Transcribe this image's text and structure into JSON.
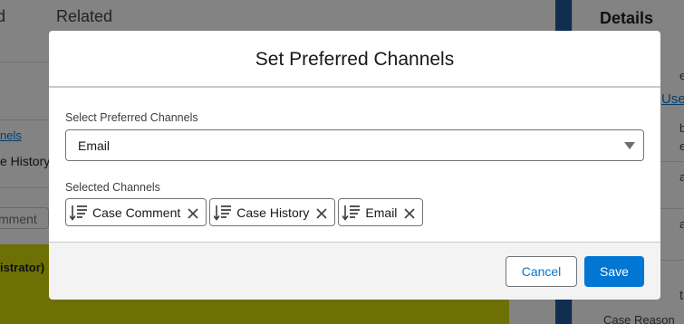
{
  "background": {
    "tabs": [
      "d",
      "Related"
    ],
    "link_fragment": "nels",
    "history_fragment": "e History",
    "comment_fragment": "mment",
    "banner_fragment": "istrator)",
    "details_title": "Details",
    "right_fragments": [
      "er",
      "Use",
      "ber",
      "e",
      "ame",
      "ame",
      "tal",
      "Case Reason"
    ]
  },
  "modal": {
    "title": "Set Preferred Channels",
    "select_label": "Select Preferred Channels",
    "select_value": "Email",
    "selected_label": "Selected Channels",
    "pills": [
      {
        "label": "Case Comment",
        "icon": "drag-handle-icon",
        "remove_icon": "close-icon"
      },
      {
        "label": "Case History",
        "icon": "drag-handle-icon",
        "remove_icon": "close-icon"
      },
      {
        "label": "Email",
        "icon": "drag-handle-icon",
        "remove_icon": "close-icon"
      }
    ],
    "cancel_label": "Cancel",
    "save_label": "Save"
  },
  "colors": {
    "brand": "#0176d3",
    "backdrop": "rgba(8,7,7,0.5)",
    "banner": "#d3d800"
  }
}
